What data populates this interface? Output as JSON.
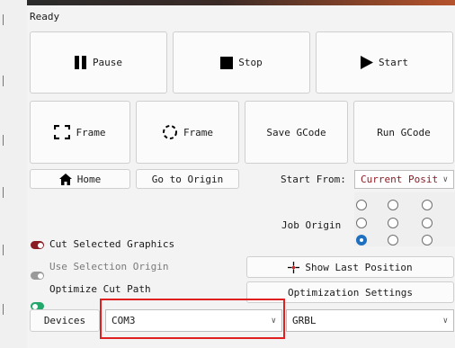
{
  "status": "Ready",
  "buttons": {
    "pause": "Pause",
    "stop": "Stop",
    "start": "Start",
    "frame_rect": "Frame",
    "frame_circle": "Frame",
    "save_gcode": "Save GCode",
    "run_gcode": "Run GCode",
    "home": "Home",
    "go_to_origin": "Go to Origin",
    "show_last_position": "Show Last Position",
    "optimization_settings": "Optimization Settings"
  },
  "start_from": {
    "label": "Start From:",
    "value": "Current Posit"
  },
  "job_origin": {
    "label": "Job Origin",
    "selected": "bottom-left"
  },
  "toggles": {
    "cut_selected": "Cut Selected Graphics",
    "use_selection_origin": "Use Selection Origin",
    "optimize_cut_path": "Optimize Cut Path"
  },
  "devices": {
    "label": "Devices",
    "port": "COM3",
    "controller": "GRBL"
  },
  "colors": {
    "accent_red": "#8b1c24",
    "accent_green": "#22a86a",
    "radio_blue": "#1f6fc0",
    "highlight": "#e02020"
  }
}
